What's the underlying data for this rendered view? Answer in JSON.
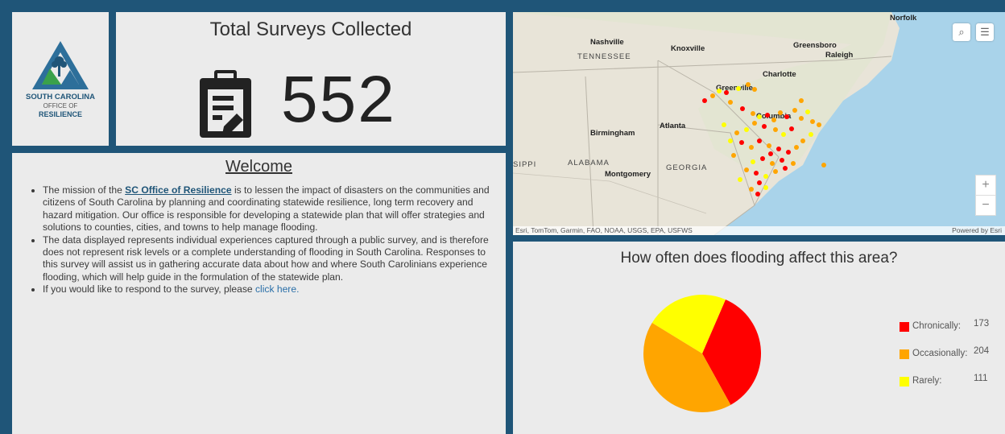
{
  "logo": {
    "line1": "SOUTH CAROLINA",
    "line2": "OFFICE OF",
    "line3": "RESILIENCE"
  },
  "summary": {
    "title": "Total Surveys Collected",
    "count": "552",
    "icon": "clipboard-icon"
  },
  "welcome": {
    "title": "Welcome",
    "p1_before": "The mission of the ",
    "p1_link": "SC Office of Resilience",
    "p1_after": " is to lessen the impact of disasters on the communities and citizens of South Carolina by planning and coordinating statewide resilience, long term recovery and hazard mitigation. Our office is responsible for developing a statewide plan that will offer strategies and solutions to counties, cities, and towns to help manage flooding.",
    "p2": "The data displayed represents individual experiences captured through a public survey, and is therefore does not represent risk levels or a complete understanding of flooding in South Carolina.  Responses to this survey will assist us in gathering accurate data about how and where South Carolinians experience flooding, which will help guide in the formulation of the statewide plan.",
    "p3_before": "If you would like to respond to the survey, please ",
    "p3_link": "click here."
  },
  "map": {
    "cities": [
      "Norfolk",
      "Nashville",
      "Knoxville",
      "Greensboro",
      "Raleigh",
      "Charlotte",
      "Greenville",
      "Columbia",
      "Atlanta",
      "Birmingham",
      "Montgomery"
    ],
    "states": [
      "TENNESSEE",
      "ALABAMA",
      "GEORGIA",
      "SIPPI"
    ],
    "attribution": "Esri, TomTom, Garmin, FAO, NOAA, USGS, EPA, USFWS",
    "powered_by": "Powered by Esri",
    "zoom_in": "+",
    "zoom_out": "−",
    "search_icon": "search-icon",
    "layers_icon": "layer-list-icon"
  },
  "chart": {
    "title": "How often does flooding affect this area?",
    "legend": [
      {
        "label": "Chronically:",
        "value": "173",
        "color": "#ff0000"
      },
      {
        "label": "Occasionally:",
        "value": "204",
        "color": "#ffa500"
      },
      {
        "label": "Rarely:",
        "value": "111",
        "color": "#ffff00"
      }
    ]
  },
  "chart_data": {
    "type": "pie",
    "title": "How often does flooding affect this area?",
    "categories": [
      "Chronically",
      "Occasionally",
      "Rarely"
    ],
    "values": [
      173,
      204,
      111
    ],
    "colors": [
      "#ff0000",
      "#ffa500",
      "#ffff00"
    ],
    "legend": "right"
  }
}
